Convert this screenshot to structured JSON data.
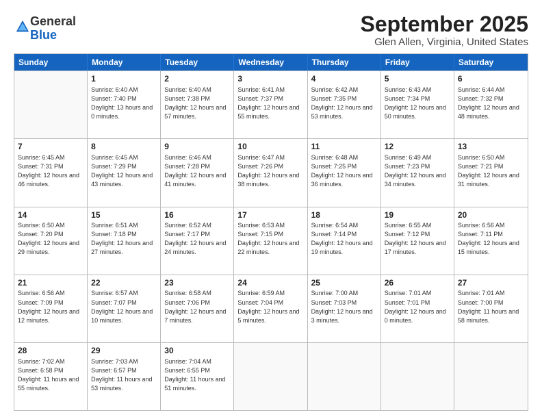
{
  "logo": {
    "general": "General",
    "blue": "Blue"
  },
  "header": {
    "month": "September 2025",
    "location": "Glen Allen, Virginia, United States"
  },
  "days": [
    "Sunday",
    "Monday",
    "Tuesday",
    "Wednesday",
    "Thursday",
    "Friday",
    "Saturday"
  ],
  "weeks": [
    [
      {
        "day": "",
        "sunrise": "",
        "sunset": "",
        "daylight": ""
      },
      {
        "day": "1",
        "sunrise": "Sunrise: 6:40 AM",
        "sunset": "Sunset: 7:40 PM",
        "daylight": "Daylight: 13 hours and 0 minutes."
      },
      {
        "day": "2",
        "sunrise": "Sunrise: 6:40 AM",
        "sunset": "Sunset: 7:38 PM",
        "daylight": "Daylight: 12 hours and 57 minutes."
      },
      {
        "day": "3",
        "sunrise": "Sunrise: 6:41 AM",
        "sunset": "Sunset: 7:37 PM",
        "daylight": "Daylight: 12 hours and 55 minutes."
      },
      {
        "day": "4",
        "sunrise": "Sunrise: 6:42 AM",
        "sunset": "Sunset: 7:35 PM",
        "daylight": "Daylight: 12 hours and 53 minutes."
      },
      {
        "day": "5",
        "sunrise": "Sunrise: 6:43 AM",
        "sunset": "Sunset: 7:34 PM",
        "daylight": "Daylight: 12 hours and 50 minutes."
      },
      {
        "day": "6",
        "sunrise": "Sunrise: 6:44 AM",
        "sunset": "Sunset: 7:32 PM",
        "daylight": "Daylight: 12 hours and 48 minutes."
      }
    ],
    [
      {
        "day": "7",
        "sunrise": "Sunrise: 6:45 AM",
        "sunset": "Sunset: 7:31 PM",
        "daylight": "Daylight: 12 hours and 46 minutes."
      },
      {
        "day": "8",
        "sunrise": "Sunrise: 6:45 AM",
        "sunset": "Sunset: 7:29 PM",
        "daylight": "Daylight: 12 hours and 43 minutes."
      },
      {
        "day": "9",
        "sunrise": "Sunrise: 6:46 AM",
        "sunset": "Sunset: 7:28 PM",
        "daylight": "Daylight: 12 hours and 41 minutes."
      },
      {
        "day": "10",
        "sunrise": "Sunrise: 6:47 AM",
        "sunset": "Sunset: 7:26 PM",
        "daylight": "Daylight: 12 hours and 38 minutes."
      },
      {
        "day": "11",
        "sunrise": "Sunrise: 6:48 AM",
        "sunset": "Sunset: 7:25 PM",
        "daylight": "Daylight: 12 hours and 36 minutes."
      },
      {
        "day": "12",
        "sunrise": "Sunrise: 6:49 AM",
        "sunset": "Sunset: 7:23 PM",
        "daylight": "Daylight: 12 hours and 34 minutes."
      },
      {
        "day": "13",
        "sunrise": "Sunrise: 6:50 AM",
        "sunset": "Sunset: 7:21 PM",
        "daylight": "Daylight: 12 hours and 31 minutes."
      }
    ],
    [
      {
        "day": "14",
        "sunrise": "Sunrise: 6:50 AM",
        "sunset": "Sunset: 7:20 PM",
        "daylight": "Daylight: 12 hours and 29 minutes."
      },
      {
        "day": "15",
        "sunrise": "Sunrise: 6:51 AM",
        "sunset": "Sunset: 7:18 PM",
        "daylight": "Daylight: 12 hours and 27 minutes."
      },
      {
        "day": "16",
        "sunrise": "Sunrise: 6:52 AM",
        "sunset": "Sunset: 7:17 PM",
        "daylight": "Daylight: 12 hours and 24 minutes."
      },
      {
        "day": "17",
        "sunrise": "Sunrise: 6:53 AM",
        "sunset": "Sunset: 7:15 PM",
        "daylight": "Daylight: 12 hours and 22 minutes."
      },
      {
        "day": "18",
        "sunrise": "Sunrise: 6:54 AM",
        "sunset": "Sunset: 7:14 PM",
        "daylight": "Daylight: 12 hours and 19 minutes."
      },
      {
        "day": "19",
        "sunrise": "Sunrise: 6:55 AM",
        "sunset": "Sunset: 7:12 PM",
        "daylight": "Daylight: 12 hours and 17 minutes."
      },
      {
        "day": "20",
        "sunrise": "Sunrise: 6:56 AM",
        "sunset": "Sunset: 7:11 PM",
        "daylight": "Daylight: 12 hours and 15 minutes."
      }
    ],
    [
      {
        "day": "21",
        "sunrise": "Sunrise: 6:56 AM",
        "sunset": "Sunset: 7:09 PM",
        "daylight": "Daylight: 12 hours and 12 minutes."
      },
      {
        "day": "22",
        "sunrise": "Sunrise: 6:57 AM",
        "sunset": "Sunset: 7:07 PM",
        "daylight": "Daylight: 12 hours and 10 minutes."
      },
      {
        "day": "23",
        "sunrise": "Sunrise: 6:58 AM",
        "sunset": "Sunset: 7:06 PM",
        "daylight": "Daylight: 12 hours and 7 minutes."
      },
      {
        "day": "24",
        "sunrise": "Sunrise: 6:59 AM",
        "sunset": "Sunset: 7:04 PM",
        "daylight": "Daylight: 12 hours and 5 minutes."
      },
      {
        "day": "25",
        "sunrise": "Sunrise: 7:00 AM",
        "sunset": "Sunset: 7:03 PM",
        "daylight": "Daylight: 12 hours and 3 minutes."
      },
      {
        "day": "26",
        "sunrise": "Sunrise: 7:01 AM",
        "sunset": "Sunset: 7:01 PM",
        "daylight": "Daylight: 12 hours and 0 minutes."
      },
      {
        "day": "27",
        "sunrise": "Sunrise: 7:01 AM",
        "sunset": "Sunset: 7:00 PM",
        "daylight": "Daylight: 11 hours and 58 minutes."
      }
    ],
    [
      {
        "day": "28",
        "sunrise": "Sunrise: 7:02 AM",
        "sunset": "Sunset: 6:58 PM",
        "daylight": "Daylight: 11 hours and 55 minutes."
      },
      {
        "day": "29",
        "sunrise": "Sunrise: 7:03 AM",
        "sunset": "Sunset: 6:57 PM",
        "daylight": "Daylight: 11 hours and 53 minutes."
      },
      {
        "day": "30",
        "sunrise": "Sunrise: 7:04 AM",
        "sunset": "Sunset: 6:55 PM",
        "daylight": "Daylight: 11 hours and 51 minutes."
      },
      {
        "day": "",
        "sunrise": "",
        "sunset": "",
        "daylight": ""
      },
      {
        "day": "",
        "sunrise": "",
        "sunset": "",
        "daylight": ""
      },
      {
        "day": "",
        "sunrise": "",
        "sunset": "",
        "daylight": ""
      },
      {
        "day": "",
        "sunrise": "",
        "sunset": "",
        "daylight": ""
      }
    ]
  ]
}
